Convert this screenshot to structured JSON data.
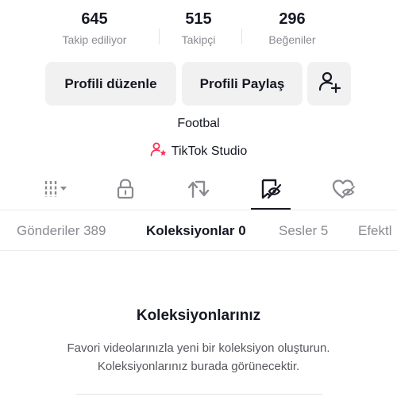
{
  "stats": [
    {
      "count": "645",
      "label": "Takip ediliyor"
    },
    {
      "count": "515",
      "label": "Takipçi"
    },
    {
      "count": "296",
      "label": "Beğeniler"
    }
  ],
  "buttons": {
    "edit_profile": "Profili düzenle",
    "share_profile": "Profili Paylaş"
  },
  "bio": "Footbal",
  "studio_link": "TikTok Studio",
  "icon_tabs": [
    {
      "icon": "grid-icon"
    },
    {
      "icon": "lock-icon"
    },
    {
      "icon": "repost-icon"
    },
    {
      "icon": "bookmark-icon",
      "active": true
    },
    {
      "icon": "liked-heart-icon"
    }
  ],
  "subtabs": [
    {
      "label": "Gönderiler 389"
    },
    {
      "label": "Koleksiyonlar 0",
      "active": true
    },
    {
      "label": "Sesler 5"
    },
    {
      "label": "Efektl"
    }
  ],
  "empty": {
    "title": "Koleksiyonlarınız",
    "line1": "Favori videolarınızla yeni bir koleksiyon oluşturun.",
    "line2": "Koleksiyonlarınız burada görünecektir."
  },
  "colors": {
    "text": "#161823",
    "muted": "#8a8b91",
    "button_bg": "#f1f1f2",
    "brand_pink": "#fe2c55"
  }
}
